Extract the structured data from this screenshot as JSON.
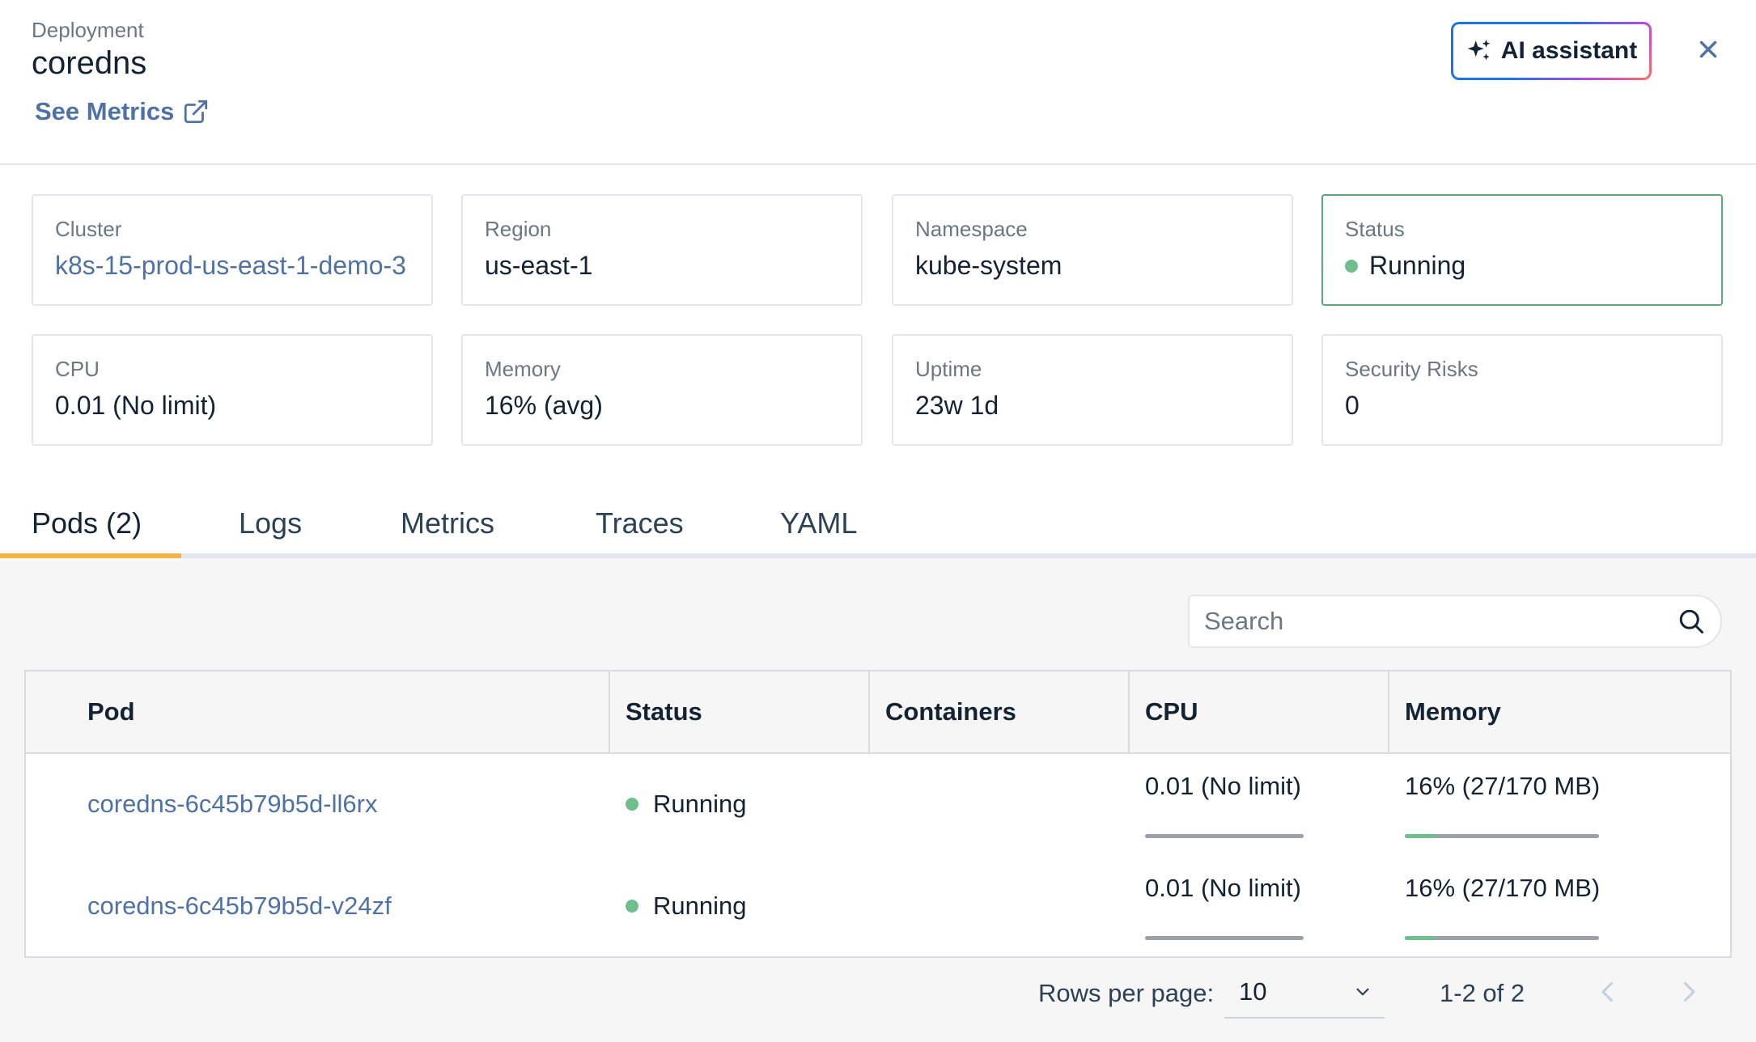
{
  "header": {
    "kind": "Deployment",
    "title": "coredns",
    "see_metrics": "See Metrics",
    "ai_assistant": "AI assistant"
  },
  "cards": {
    "cluster": {
      "label": "Cluster",
      "value": "k8s-15-prod-us-east-1-demo-3"
    },
    "region": {
      "label": "Region",
      "value": "us-east-1"
    },
    "namespace": {
      "label": "Namespace",
      "value": "kube-system"
    },
    "status": {
      "label": "Status",
      "value": "Running"
    },
    "cpu": {
      "label": "CPU",
      "value": "0.01 (No limit)"
    },
    "memory": {
      "label": "Memory",
      "value": "16% (avg)"
    },
    "uptime": {
      "label": "Uptime",
      "value": "23w 1d"
    },
    "security": {
      "label": "Security Risks",
      "value": "0"
    }
  },
  "tabs": [
    "Pods (2)",
    "Logs",
    "Metrics",
    "Traces",
    "YAML"
  ],
  "active_tab": "Pods (2)",
  "search": {
    "placeholder": "Search"
  },
  "table": {
    "columns": [
      "Pod",
      "Status",
      "Containers",
      "CPU",
      "Memory"
    ],
    "rows": [
      {
        "pod": "coredns-6c45b79b5d-ll6rx",
        "status": "Running",
        "containers": "",
        "cpu": "0.01 (No limit)",
        "memory": "16% (27/170 MB)",
        "memory_fraction": 0.16
      },
      {
        "pod": "coredns-6c45b79b5d-v24zf",
        "status": "Running",
        "containers": "",
        "cpu": "0.01 (No limit)",
        "memory": "16% (27/170 MB)",
        "memory_fraction": 0.16
      }
    ]
  },
  "pagination": {
    "rows_per_page_label": "Rows per page:",
    "rows_per_page": "10",
    "range": "1-2 of 2"
  },
  "colors": {
    "link": "#4f72a6",
    "running": "#6fbf8c",
    "tab_accent": "#f2b544"
  }
}
